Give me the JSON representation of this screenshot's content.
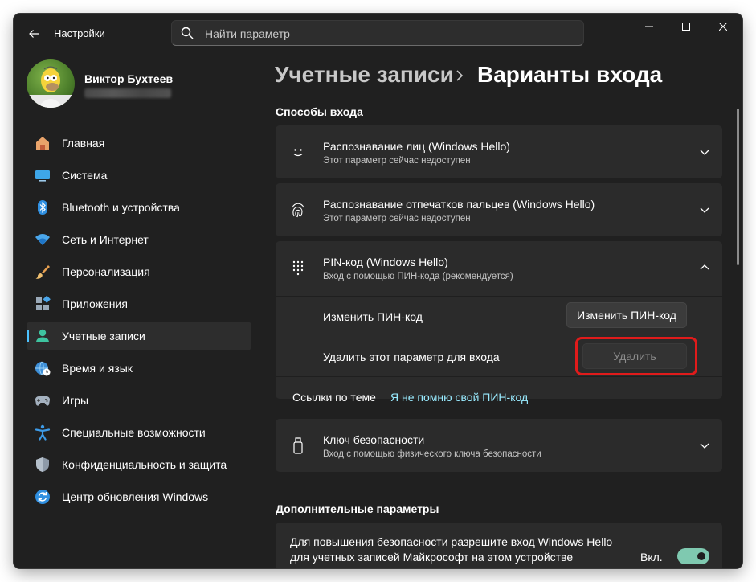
{
  "window": {
    "app_title": "Настройки",
    "search_placeholder": "Найти параметр"
  },
  "user": {
    "name": "Виктор Бухтеев"
  },
  "sidebar": {
    "items": [
      {
        "label": "Главная",
        "icon": "home-icon"
      },
      {
        "label": "Система",
        "icon": "monitor-icon"
      },
      {
        "label": "Bluetooth и устройства",
        "icon": "bluetooth-icon"
      },
      {
        "label": "Сеть и Интернет",
        "icon": "wifi-icon"
      },
      {
        "label": "Персонализация",
        "icon": "brush-icon"
      },
      {
        "label": "Приложения",
        "icon": "apps-icon"
      },
      {
        "label": "Учетные записи",
        "icon": "person-icon",
        "active": true
      },
      {
        "label": "Время и язык",
        "icon": "globe-clock-icon"
      },
      {
        "label": "Игры",
        "icon": "gamepad-icon"
      },
      {
        "label": "Специальные возможности",
        "icon": "accessibility-icon"
      },
      {
        "label": "Конфиденциальность и защита",
        "icon": "shield-icon"
      },
      {
        "label": "Центр обновления Windows",
        "icon": "update-icon"
      }
    ]
  },
  "breadcrumb": {
    "parent": "Учетные записи",
    "current": "Варианты входа"
  },
  "signin": {
    "section_title": "Способы входа",
    "face": {
      "title": "Распознавание лиц (Windows Hello)",
      "subtitle": "Этот параметр сейчас недоступен"
    },
    "fingerprint": {
      "title": "Распознавание отпечатков пальцев (Windows Hello)",
      "subtitle": "Этот параметр сейчас недоступен"
    },
    "pin": {
      "title": "PIN-код (Windows Hello)",
      "subtitle": "Вход с помощью ПИН-кода (рекомендуется)",
      "change_label": "Изменить ПИН-код",
      "change_button": "Изменить ПИН-код",
      "remove_label": "Удалить этот параметр для входа",
      "remove_button": "Удалить",
      "links_label": "Ссылки по теме",
      "forgot_link": "Я не помню свой ПИН-код"
    },
    "security_key": {
      "title": "Ключ безопасности",
      "subtitle": "Вход с помощью физического ключа безопасности"
    }
  },
  "additional": {
    "section_title": "Дополнительные параметры",
    "line1": "Для повышения безопасности разрешите вход Windows Hello",
    "line2": "для учетных записей Майкрософт на этом устройстве",
    "toggle_label": "Вкл.",
    "toggle_on": true
  },
  "colors": {
    "accent": "#4cc2ff",
    "link": "#99ebff",
    "highlight": "#e01b1b",
    "toggle": "#7fc9b0"
  }
}
